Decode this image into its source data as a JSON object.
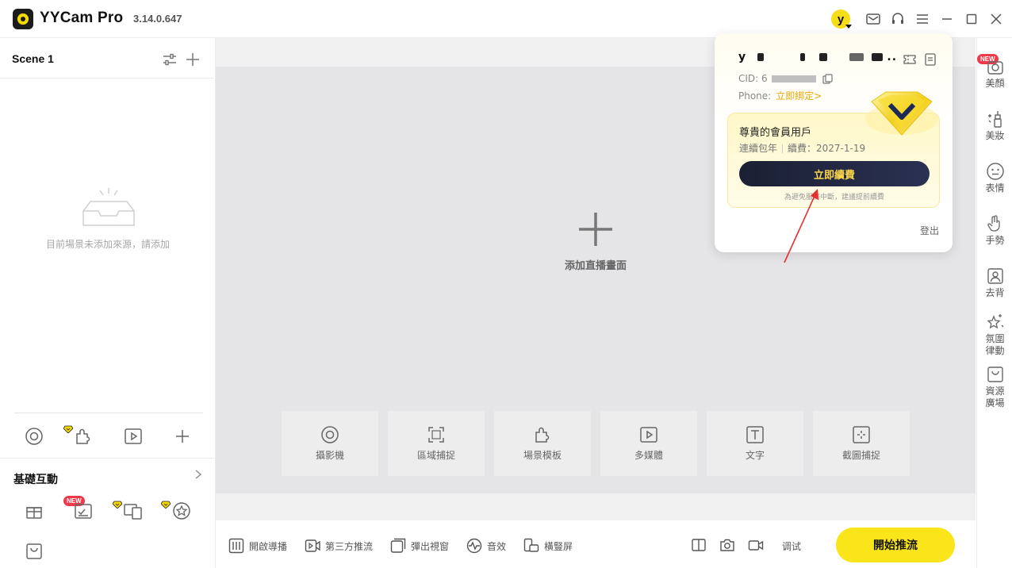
{
  "titlebar": {
    "app_name": "YYCam Pro",
    "version": "3.14.0.647",
    "avatar_letter": "y",
    "icons": [
      "mail-icon",
      "headset-icon",
      "menu-icon",
      "minimize-icon",
      "maximize-icon",
      "close-icon"
    ]
  },
  "scene": {
    "title": "Scene 1",
    "empty_text": "目前場景未添加來源，請添加"
  },
  "basic": {
    "title": "基礎互動",
    "new_badge": "NEW"
  },
  "center": {
    "add_text": "添加直播畫面",
    "tiles": [
      "攝影機",
      "區域捕捉",
      "場景模板",
      "多媒體",
      "文字",
      "截圖捕捉"
    ]
  },
  "bottombar": {
    "guide": "開啟導播",
    "third_party": "第三方推流",
    "popup_window": "彈出視窗",
    "sound": "音效",
    "orientation": "橫豎屏",
    "debug": "调试",
    "start": "開始推流"
  },
  "rightrail": {
    "new_badge": "NEW",
    "items": [
      "美顏",
      "美妝",
      "表情",
      "手勢",
      "去背",
      "氛圍\n律動",
      "資源\n廣場"
    ]
  },
  "popup": {
    "name_prefix": "y",
    "name_suffix": "..",
    "cid": "CID: 6",
    "phone_label": "Phone:",
    "phone_link": "立即綁定>",
    "vip_title": "尊貴的會員用戶",
    "vip_plan": "連續包年",
    "vip_renew": "續費：2027-1-19",
    "renew_button": "立即續費",
    "vip_note": "為避免服務中斷，建議提前續費",
    "logout": "登出"
  },
  "colors": {
    "accent_yellow": "#fae51a",
    "new_red": "#ee3a4a",
    "link_orange": "#e7a800",
    "dark_button": "#1b2033"
  }
}
